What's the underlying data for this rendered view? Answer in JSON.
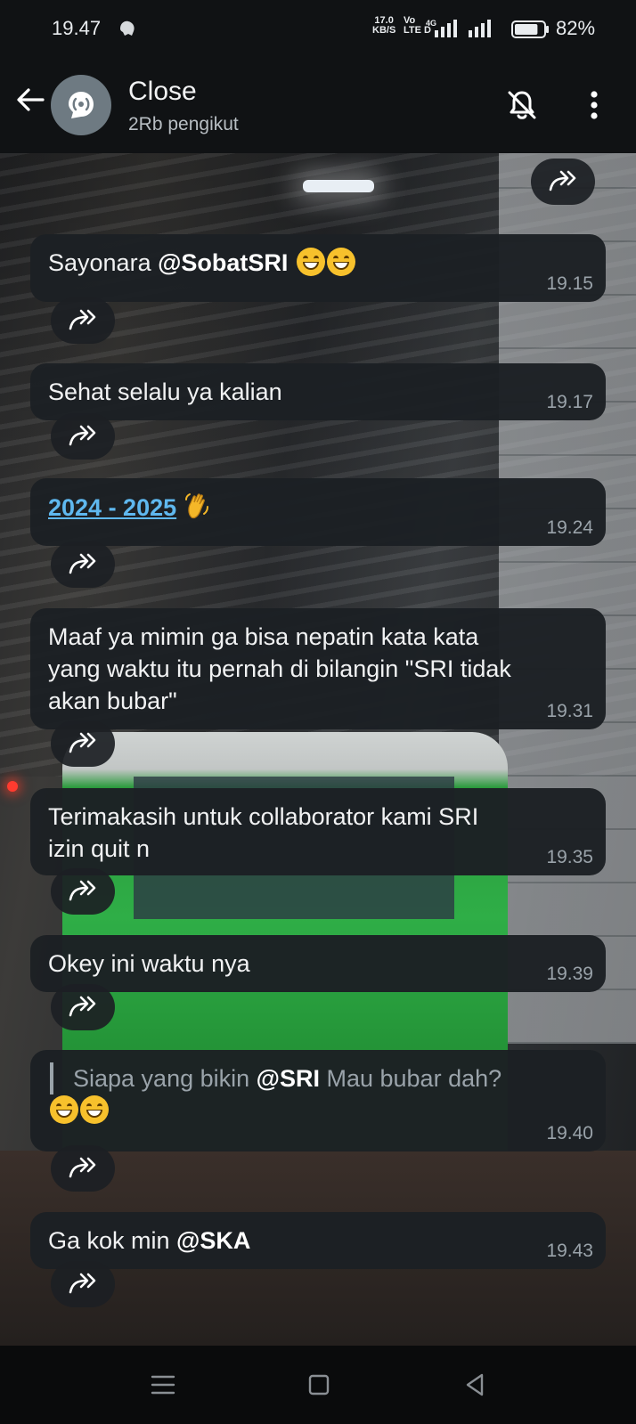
{
  "status_bar": {
    "time": "19.47",
    "speed_value": "17.0",
    "speed_unit": "KB/S",
    "volte_top": "Vo",
    "volte_bottom": "LTE D",
    "network": "4G",
    "battery": "82%",
    "battery_level": 0.82
  },
  "header": {
    "title": "Close",
    "subtitle": "2Rb pengikut"
  },
  "messages": [
    {
      "time": "19.15"
    },
    {
      "text": "Sehat selalu ya kalian",
      "time": "19.17"
    },
    {
      "link": "2024 - 2025",
      "time": "19.24"
    },
    {
      "text": "Maaf ya mimin ga bisa nepatin kata kata\nyang waktu itu pernah di bilangin \"SRI tidak\nakan bubar\"",
      "time": "19.31"
    },
    {
      "text": "Terimakasih untuk collaborator kami SRI\nizin quit n",
      "time": "19.35"
    },
    {
      "text": "Okey ini waktu nya",
      "time": "19.39"
    },
    {
      "time": "19.40"
    },
    {
      "time": "19.43"
    }
  ],
  "msg1": {
    "prefix": "Sayonara ",
    "mention": "@SobatSRI"
  },
  "msg7": {
    "quote_prefix": "Siapa yang bikin ",
    "quote_mention": "@SRI",
    "quote_suffix": " Mau bubar dah?"
  },
  "msg8": {
    "prefix": "Ga kok min ",
    "mention": "@SKA"
  },
  "colors": {
    "link": "#5fb8ef",
    "bubble": "#1c2024",
    "time": "#9aa3aa"
  }
}
